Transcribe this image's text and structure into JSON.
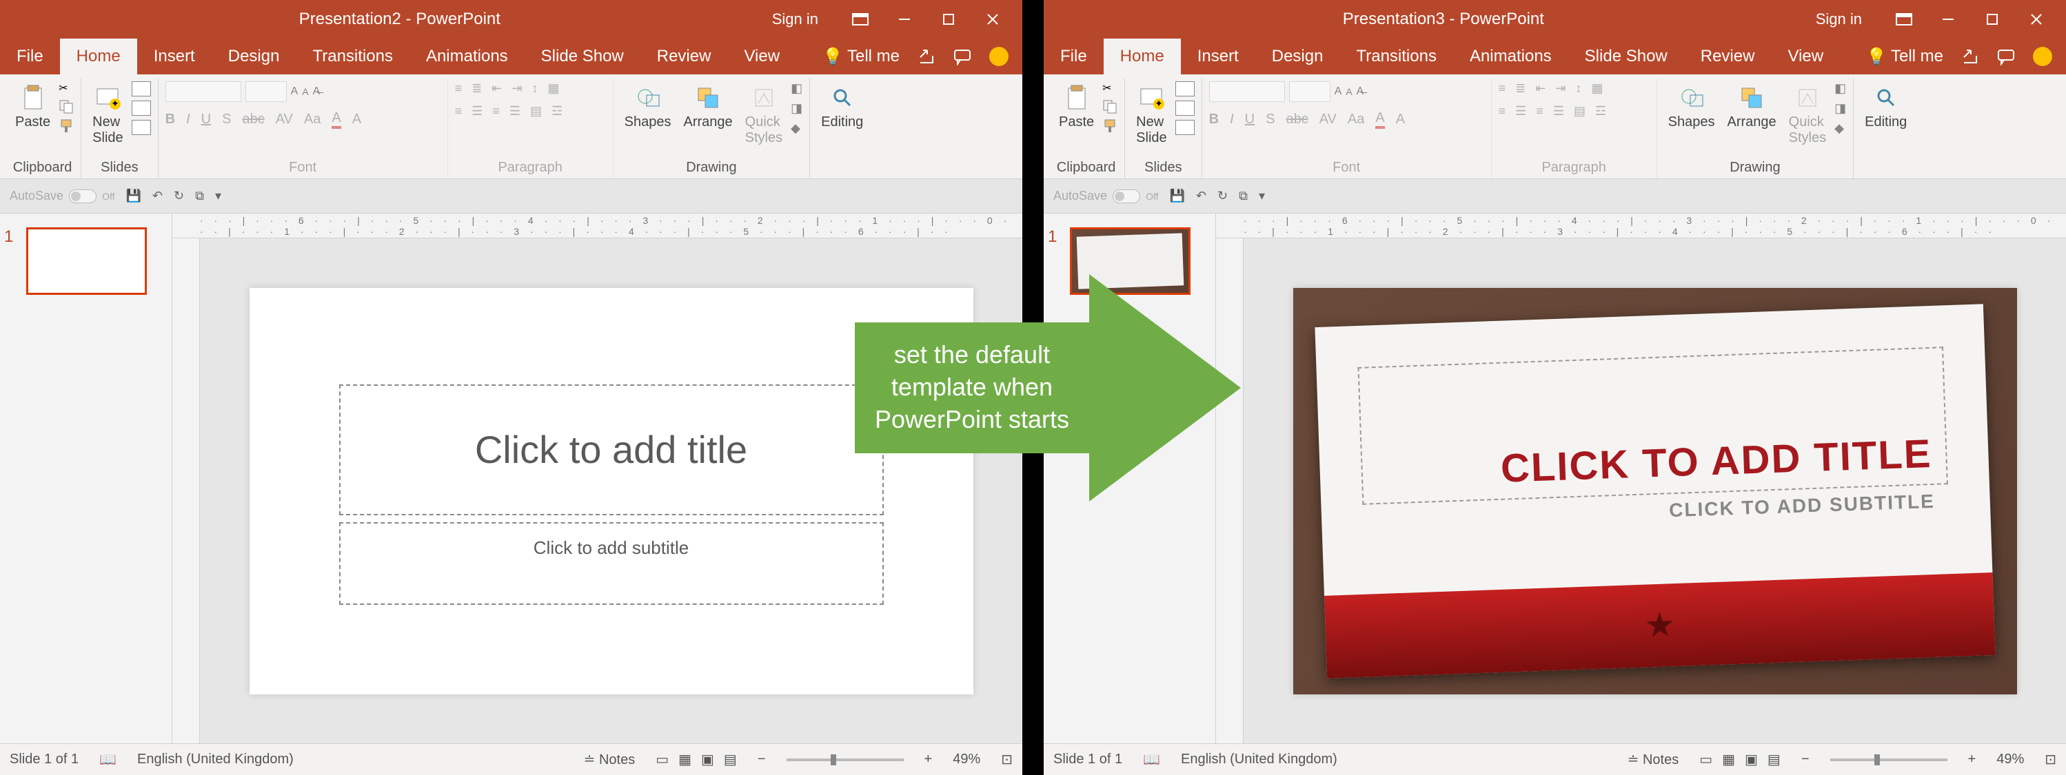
{
  "leftWindow": {
    "title": "Presentation2  -  PowerPoint",
    "signIn": "Sign in",
    "tabs": [
      "File",
      "Home",
      "Insert",
      "Design",
      "Transitions",
      "Animations",
      "Slide Show",
      "Review",
      "View"
    ],
    "activeTab": "Home",
    "tellMe": "Tell me",
    "groups": {
      "clipboard": {
        "label": "Clipboard",
        "paste": "Paste"
      },
      "slides": {
        "label": "Slides",
        "newSlide": "New\nSlide"
      },
      "font": {
        "label": "Font"
      },
      "paragraph": {
        "label": "Paragraph"
      },
      "drawing": {
        "label": "Drawing",
        "shapes": "Shapes",
        "arrange": "Arrange",
        "quickStyles": "Quick\nStyles"
      },
      "editing": {
        "label": "Editing"
      }
    },
    "fontBtns": [
      "B",
      "I",
      "U",
      "S",
      "abc",
      "AV",
      "Aa",
      "A",
      "A"
    ],
    "autosave": "AutoSave",
    "autosaveState": "Off",
    "ruler": "· · · | · · · 6 · · · | · · · 5 · · · | · · · 4 · · · | · · · 3 · · · | · · · 2 · · · | · · · 1 · · · | · · · 0 · · · | · · · 1 · · · | · · · 2 · · · | · · · 3 · · · | · · · 4 · · · | · · · 5 · · · | · · · 6 · · · | · ·",
    "slideNum": "1",
    "placeholderTitle": "Click to add title",
    "placeholderSub": "Click to add subtitle",
    "status": {
      "slideCount": "Slide 1 of 1",
      "language": "English (United Kingdom)",
      "notes": "Notes",
      "zoom": "49%"
    }
  },
  "rightWindow": {
    "title": "Presentation3  -  PowerPoint",
    "signIn": "Sign in",
    "tabs": [
      "File",
      "Home",
      "Insert",
      "Design",
      "Transitions",
      "Animations",
      "Slide Show",
      "Review",
      "View"
    ],
    "activeTab": "Home",
    "tellMe": "Tell me",
    "groups": {
      "clipboard": {
        "label": "Clipboard",
        "paste": "Paste"
      },
      "slides": {
        "label": "Slides",
        "newSlide": "New\nSlide"
      },
      "font": {
        "label": "Font"
      },
      "paragraph": {
        "label": "Paragraph"
      },
      "drawing": {
        "label": "Drawing",
        "shapes": "Shapes",
        "arrange": "Arrange",
        "quickStyles": "Quick\nStyles"
      },
      "editing": {
        "label": "Editing"
      }
    },
    "fontBtns": [
      "B",
      "I",
      "U",
      "S",
      "abc",
      "AV",
      "Aa",
      "A",
      "A"
    ],
    "autosave": "AutoSave",
    "autosaveState": "Off",
    "ruler": "· · · | · · · 6 · · · | · · · 5 · · · | · · · 4 · · · | · · · 3 · · · | · · · 2 · · · | · · · 1 · · · | · · · 0 · · · | · · · 1 · · · | · · · 2 · · · | · · · 3 · · · | · · · 4 · · · | · · · 5 · · · | · · · 6 · · · | · ·",
    "slideNum": "1",
    "placeholderTitle": "CLICK TO ADD TITLE",
    "placeholderSub": "CLICK TO ADD SUBTITLE",
    "status": {
      "slideCount": "Slide 1 of 1",
      "language": "English (United Kingdom)",
      "notes": "Notes",
      "zoom": "49%"
    }
  },
  "arrowText": "set the default template when PowerPoint starts"
}
